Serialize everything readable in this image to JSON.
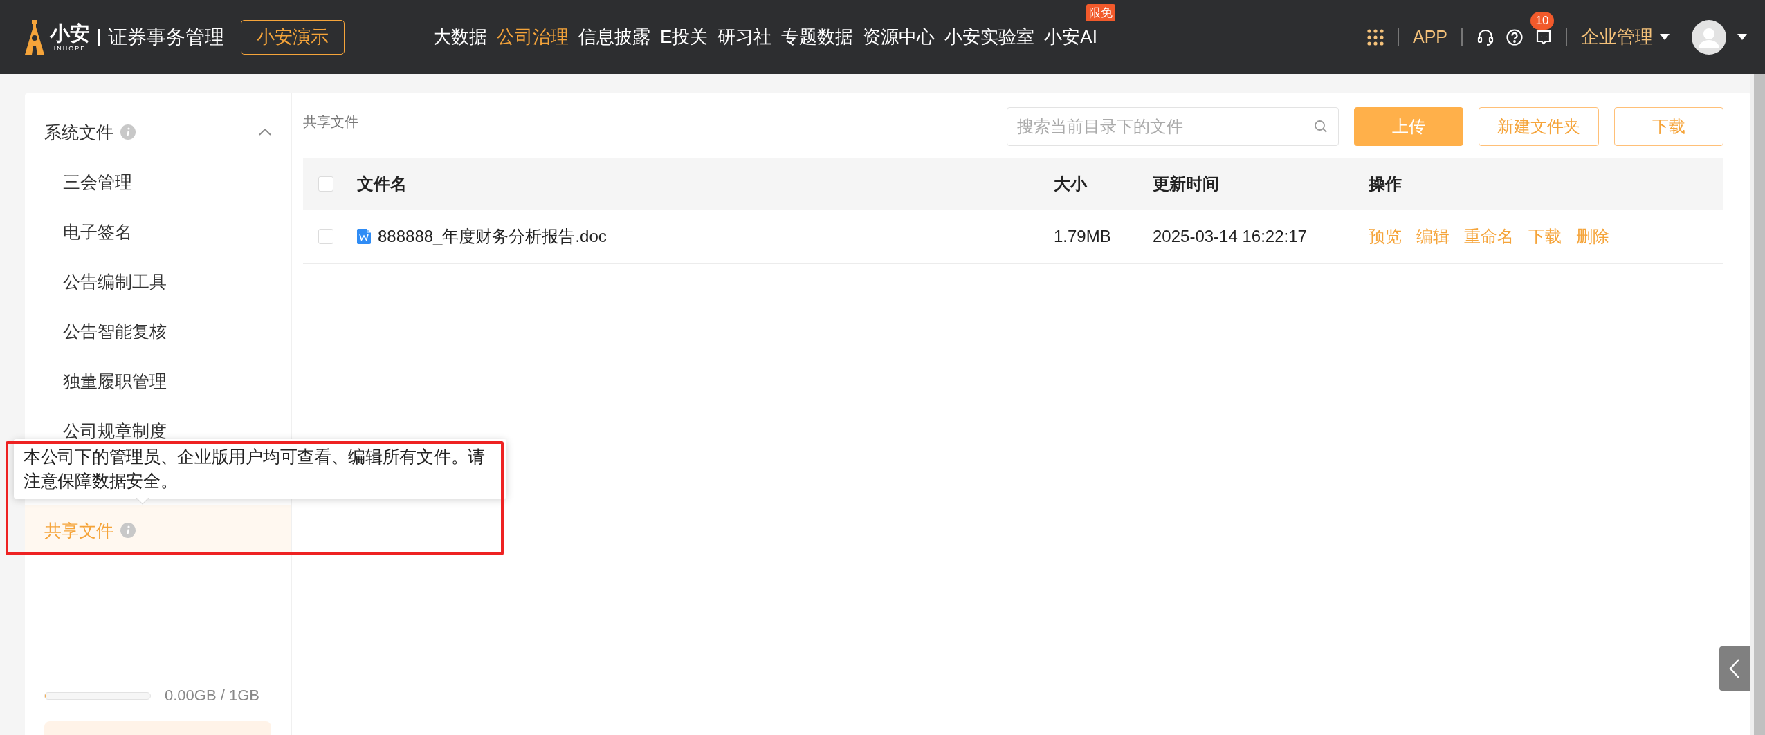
{
  "header": {
    "logo": {
      "name": "小安",
      "sub": "INHOPE"
    },
    "product": "证券事务管理",
    "demo_button": "小安演示",
    "nav": [
      {
        "label": "大数据",
        "selected": false
      },
      {
        "label": "公司治理",
        "selected": true
      },
      {
        "label": "信息披露",
        "selected": false
      },
      {
        "label": "E投关",
        "selected": false
      },
      {
        "label": "研习社",
        "selected": false
      },
      {
        "label": "专题数据",
        "selected": false
      },
      {
        "label": "资源中心",
        "selected": false
      },
      {
        "label": "小安实验室",
        "selected": false
      },
      {
        "label": "小安AI",
        "selected": false,
        "badge": "限免"
      }
    ],
    "app_link": "APP",
    "notification_count": "10",
    "org_menu": "企业管理"
  },
  "sidebar": {
    "sections": [
      {
        "label": "系统文件",
        "selected": false,
        "expanded": true,
        "children": [
          {
            "label": "三会管理",
            "selected": false
          },
          {
            "label": "电子签名",
            "selected": false
          },
          {
            "label": "公告编制工具",
            "selected": false
          },
          {
            "label": "公告智能复核",
            "selected": false
          },
          {
            "label": "独董履职管理",
            "selected": false
          },
          {
            "label": "公司规章制度",
            "selected": false
          }
        ]
      },
      {
        "label": "共享文件",
        "selected": true
      }
    ],
    "tooltip": "本公司下的管理员、企业版用户均可查看、编辑所有文件。请注意保障数据安全。",
    "storage": {
      "level": 0.01,
      "reading": "0.00GB / 1GB"
    }
  },
  "main": {
    "breadcrumb": "共享文件",
    "search": {
      "placeholder": "搜索当前目录下的文件"
    },
    "buttons": [
      {
        "label": "上传",
        "kind": "primary"
      },
      {
        "label": "新建文件夹",
        "kind": "outline"
      },
      {
        "label": "下载",
        "kind": "outline"
      }
    ],
    "table": {
      "all_checked": false,
      "columns": [
        "文件名",
        "大小",
        "更新时间",
        "操作"
      ],
      "rows": [
        {
          "checked": false,
          "name": "888888_年度财务分析报告.doc",
          "size": "1.79MB",
          "updated": "2025-03-14 16:22:17",
          "actions": [
            "预览",
            "编辑",
            "重命名",
            "下载",
            "删除"
          ]
        }
      ]
    }
  }
}
